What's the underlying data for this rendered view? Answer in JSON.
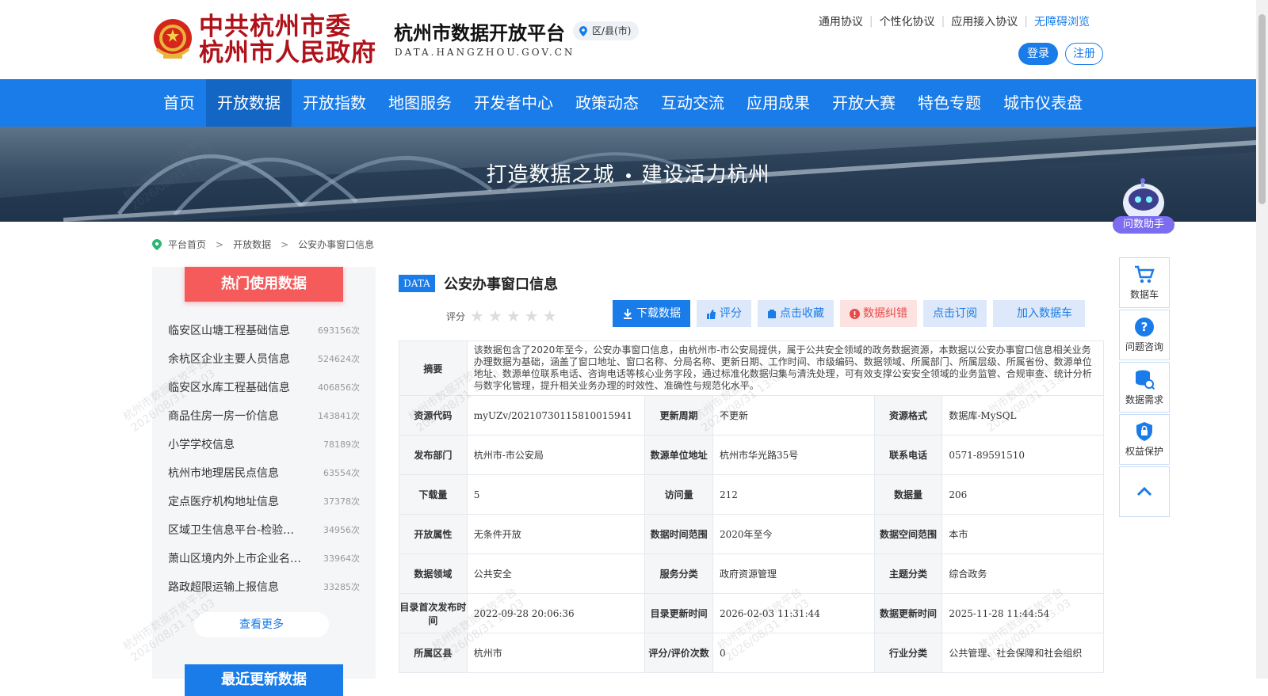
{
  "header": {
    "gov_name_line1": "中共杭州市委",
    "gov_name_line2": "杭州市人民政府",
    "platform_title": "杭州市数据开放平台",
    "platform_domain": "DATA.HANGZHOU.GOV.CN",
    "region_selector": "区/县(市)",
    "links": [
      "通用协议",
      "个性化协议",
      "应用接入协议",
      "无障碍浏览"
    ],
    "login": "登录",
    "register": "注册"
  },
  "nav": {
    "items": [
      "首页",
      "开放数据",
      "开放指数",
      "地图服务",
      "开发者中心",
      "政策动态",
      "互动交流",
      "应用成果",
      "开放大赛",
      "特色专题",
      "城市仪表盘"
    ],
    "active_index": 1
  },
  "banner": {
    "slogan_left": "打造数据之城",
    "slogan_right": "建设活力杭州"
  },
  "assistant": {
    "label": "问数助手"
  },
  "breadcrumb": [
    "平台首页",
    "开放数据",
    "公安办事窗口信息"
  ],
  "sidebar": {
    "hot_title": "热门使用数据",
    "hot_items": [
      {
        "name": "临安区山塘工程基础信息",
        "count": "693156次"
      },
      {
        "name": "余杭区企业主要人员信息",
        "count": "524624次"
      },
      {
        "name": "临安区水库工程基础信息",
        "count": "406856次"
      },
      {
        "name": "商品住房一房一价信息",
        "count": "143841次"
      },
      {
        "name": "小学学校信息",
        "count": "78189次"
      },
      {
        "name": "杭州市地理居民点信息",
        "count": "63554次"
      },
      {
        "name": "定点医疗机构地址信息",
        "count": "37378次"
      },
      {
        "name": "区域卫生信息平台-检验…",
        "count": "34956次"
      },
      {
        "name": "萧山区境内外上市企业名…",
        "count": "33964次"
      },
      {
        "name": "路政超限运输上报信息",
        "count": "33285次"
      }
    ],
    "more": "查看更多",
    "recent_title": "最近更新数据"
  },
  "dataset": {
    "tag": "DATA",
    "title": "公安办事窗口信息",
    "rating_label": "评分",
    "actions": [
      "下载数据",
      "评分",
      "点击收藏",
      "数据纠错",
      "点击订阅",
      "加入数据车"
    ],
    "abstract_label": "摘要",
    "abstract": "该数据包含了2020年至今，公安办事窗口信息，由杭州市-市公安局提供，属于公共安全领域的政务数据资源，本数据以公安办事窗口信息相关业务办理数据为基础，涵盖了窗口地址、窗口名称、分局名称、更新日期、工作时间、市级编码、数据领域、所属部门、所属层级、所属省份、数源单位地址、数源单位联系电话、咨询电话等核心业务字段，通过标准化数据归集与清洗处理，可有效支撑公安安全领域的业务监管、合规审查、统计分析与数字化管理，提升相关业务办理的时效性、准确性与规范化水平。",
    "rows": [
      [
        {
          "l": "资源代码",
          "v": "myUZv/20210730115810015941"
        },
        {
          "l": "更新周期",
          "v": "不更新"
        },
        {
          "l": "资源格式",
          "v": "数据库-MySQL"
        }
      ],
      [
        {
          "l": "发布部门",
          "v": "杭州市-市公安局"
        },
        {
          "l": "数源单位地址",
          "v": "杭州市华光路35号"
        },
        {
          "l": "联系电话",
          "v": "0571-89591510"
        }
      ],
      [
        {
          "l": "下载量",
          "v": "5"
        },
        {
          "l": "访问量",
          "v": "212"
        },
        {
          "l": "数据量",
          "v": "206"
        }
      ],
      [
        {
          "l": "开放属性",
          "v": "无条件开放"
        },
        {
          "l": "数据时间范围",
          "v": "2020年至今"
        },
        {
          "l": "数据空间范围",
          "v": "本市"
        }
      ],
      [
        {
          "l": "数据领域",
          "v": "公共安全"
        },
        {
          "l": "服务分类",
          "v": "政府资源管理"
        },
        {
          "l": "主题分类",
          "v": "综合政务"
        }
      ],
      [
        {
          "l": "目录首次发布时间",
          "v": "2022-09-28 20:06:36"
        },
        {
          "l": "目录更新时间",
          "v": "2026-02-03 11:31:44"
        },
        {
          "l": "数据更新时间",
          "v": "2025-11-28 11:44:54"
        }
      ],
      [
        {
          "l": "所属区县",
          "v": "杭州市"
        },
        {
          "l": "评分/评价次数",
          "v": "0"
        },
        {
          "l": "行业分类",
          "v": "公共管理、社会保障和社会组织"
        }
      ]
    ]
  },
  "side_tools": [
    "数据车",
    "问题咨询",
    "数据需求",
    "权益保护"
  ],
  "watermark": {
    "line1": "杭州市数据开放平台",
    "line2": "2026/08/31 13:03"
  },
  "colors": {
    "primary": "#1a7ce8",
    "hot": "#f55b5b",
    "gov_red": "#b0121a"
  }
}
